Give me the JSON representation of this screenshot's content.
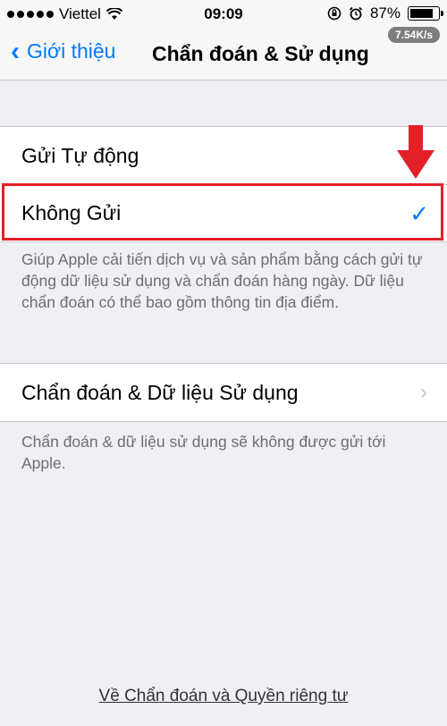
{
  "status": {
    "carrier": "Viettel",
    "time": "09:09",
    "battery_percent": "87%",
    "battery_level": 0.87,
    "network_speed": "7.54K/s"
  },
  "nav": {
    "back_label": "Giới thiệu",
    "title": "Chẩn đoán & Sử dụng"
  },
  "options": {
    "auto_send": "Gửi Tự động",
    "dont_send": "Không Gửi",
    "selected": "dont_send"
  },
  "options_footer": "Giúp Apple cải tiến dịch vụ và sản phẩm bằng cách gửi tự động dữ liệu sử dụng và chẩn đoán hàng ngày. Dữ liệu chẩn đoán có thể bao gồm thông tin địa điểm.",
  "diagnostics": {
    "label": "Chẩn đoán & Dữ liệu Sử dụng",
    "footer": "Chẩn đoán & dữ liệu sử dụng sẽ không được gửi tới Apple."
  },
  "privacy_link": "Về Chẩn đoán và Quyền riêng tư",
  "colors": {
    "accent": "#007aff",
    "highlight": "#e32027",
    "background": "#efeff4"
  }
}
